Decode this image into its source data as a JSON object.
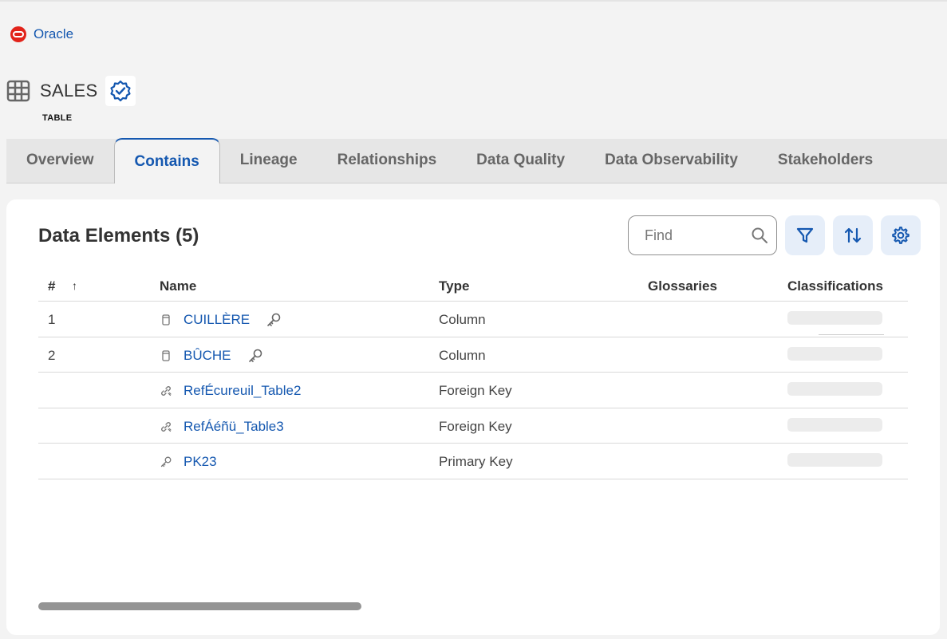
{
  "breadcrumb": {
    "label": "Oracle"
  },
  "asset": {
    "title": "SALES",
    "subtype": "TABLE"
  },
  "tabs": [
    {
      "label": "Overview"
    },
    {
      "label": "Contains",
      "active": true
    },
    {
      "label": "Lineage"
    },
    {
      "label": "Relationships"
    },
    {
      "label": "Data Quality"
    },
    {
      "label": "Data Observability"
    },
    {
      "label": "Stakeholders"
    }
  ],
  "panel": {
    "title": "Data Elements (5)",
    "find_placeholder": "Find"
  },
  "grid": {
    "columns": {
      "num": "#",
      "sort_indicator": "↑",
      "name": "Name",
      "type": "Type",
      "glossaries": "Glossaries",
      "classifications": "Classifications"
    },
    "rows": [
      {
        "num": "1",
        "icon": "column-icon",
        "name": "CUILLÈRE",
        "has_key": true,
        "type": "Column"
      },
      {
        "num": "2",
        "icon": "column-icon",
        "name": "BÛCHE",
        "has_key": true,
        "type": "Column"
      },
      {
        "num": "",
        "icon": "link-icon",
        "name": "RefÉcureuil_Table2",
        "has_key": false,
        "type": "Foreign Key"
      },
      {
        "num": "",
        "icon": "link-icon",
        "name": "RefÁéñü_Table3",
        "has_key": false,
        "type": "Foreign Key"
      },
      {
        "num": "",
        "icon": "key-icon",
        "name": "PK23",
        "has_key": false,
        "type": "Primary Key"
      }
    ]
  },
  "colors": {
    "accent": "#1558b0",
    "oracle_red": "#e2231a"
  }
}
